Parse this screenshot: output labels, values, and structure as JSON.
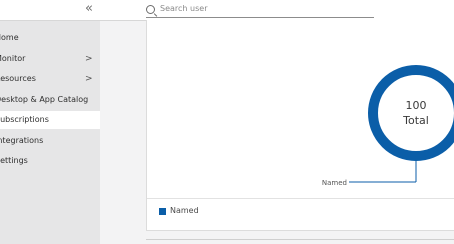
{
  "topbar": {
    "collapse_icon": "double-chevron-left-icon",
    "collapse_glyph": "«",
    "search_placeholder": "Search user"
  },
  "sidebar": {
    "items": [
      {
        "label": "Home",
        "has_children": false,
        "active": false
      },
      {
        "label": "Monitor",
        "has_children": true,
        "active": false
      },
      {
        "label": "Resources",
        "has_children": true,
        "active": false
      },
      {
        "label": "Desktop & App Catalog",
        "has_children": false,
        "active": false
      },
      {
        "label": "Subscriptions",
        "has_children": false,
        "active": true
      },
      {
        "label": "Integrations",
        "has_children": false,
        "active": false
      },
      {
        "label": "Settings",
        "has_children": false,
        "active": false
      }
    ],
    "chevron_glyph": ">"
  },
  "chart_data": {
    "type": "pie",
    "categories": [
      "Named"
    ],
    "values": [
      100
    ],
    "center_value": "100",
    "center_label": "Total",
    "slice_label": "Named",
    "legend": [
      {
        "name": "Named",
        "color": "#0b5ea8"
      }
    ],
    "legend_placement": "bottom-left",
    "colors": {
      "Named": "#0b5ea8"
    }
  }
}
